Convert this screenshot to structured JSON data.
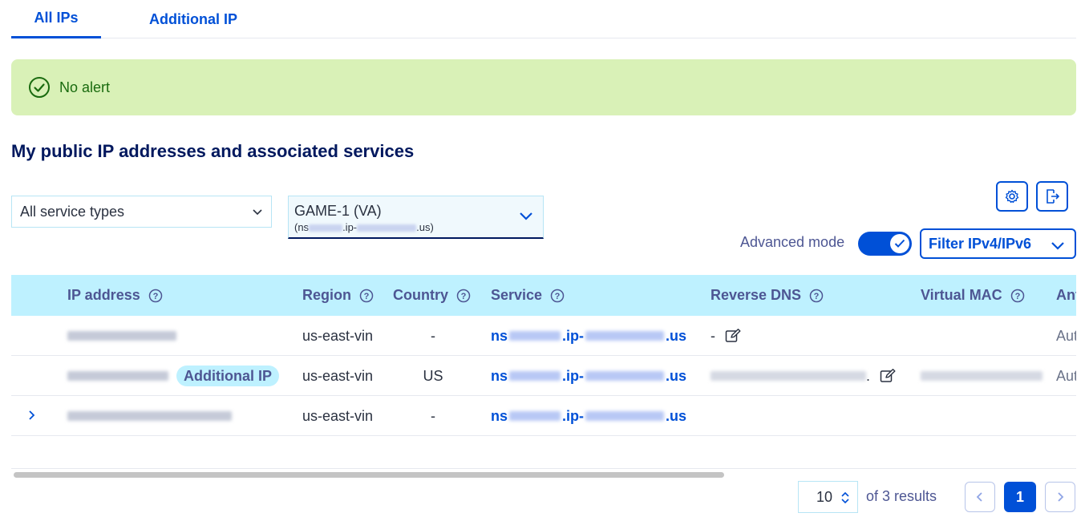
{
  "tabs": [
    {
      "label": "All IPs",
      "active": true
    },
    {
      "label": "Additional IP",
      "active": false
    }
  ],
  "alert": {
    "text": "No alert",
    "icon": "check-circle-icon",
    "color": "#1a6b0f",
    "background": "#d9f1b7"
  },
  "section_title": "My public IP addresses and associated services",
  "filters": {
    "service_type": "All service types",
    "server_main": "GAME-1 (VA)",
    "server_sub_prefix": "(ns",
    "server_sub_mid": ".ip-",
    "server_sub_suffix": ".us)",
    "advanced_mode_label": "Advanced mode",
    "advanced_mode_on": true,
    "filter_button": "Filter IPv4/IPv6"
  },
  "table": {
    "headers": {
      "ip_address": "IP address",
      "region": "Region",
      "country": "Country",
      "service": "Service",
      "reverse_dns": "Reverse DNS",
      "virtual_mac": "Virtual MAC",
      "anti": "Ant"
    },
    "rows": [
      {
        "region": "us-east-vin",
        "country": "-",
        "service_prefix": "ns",
        "service_mid": ".ip-",
        "service_suffix": ".us",
        "reverse_dns": "-",
        "anti": "Aut",
        "badge": ""
      },
      {
        "region": "us-east-vin",
        "country": "US",
        "service_prefix": "ns",
        "service_mid": ".ip-",
        "service_suffix": ".us",
        "reverse_dns": ".",
        "anti": "Aut",
        "badge": "Additional IP"
      },
      {
        "region": "us-east-vin",
        "country": "-",
        "service_prefix": "ns",
        "service_mid": ".ip-",
        "service_suffix": ".us",
        "reverse_dns": "",
        "anti": "",
        "badge": ""
      }
    ]
  },
  "pagination": {
    "page_size": "10",
    "results_text": "of 3 results",
    "current_page": "1"
  },
  "colors": {
    "accent": "#0050d7",
    "header_bg": "#bef1ff",
    "title": "#00185e"
  }
}
